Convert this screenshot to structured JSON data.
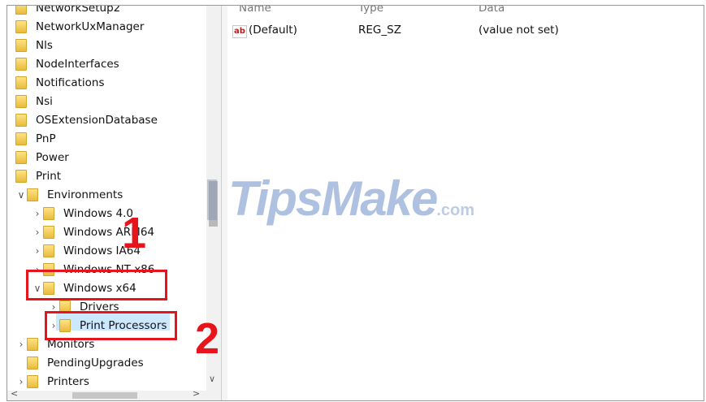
{
  "tree": {
    "items": [
      {
        "label": "NetworkSetup2",
        "expander": "",
        "level": 0
      },
      {
        "label": "NetworkUxManager",
        "expander": "",
        "level": 0
      },
      {
        "label": "Nls",
        "expander": "",
        "level": 0
      },
      {
        "label": "NodeInterfaces",
        "expander": "",
        "level": 0
      },
      {
        "label": "Notifications",
        "expander": "",
        "level": 0
      },
      {
        "label": "Nsi",
        "expander": "",
        "level": 0
      },
      {
        "label": "OSExtensionDatabase",
        "expander": "",
        "level": 0
      },
      {
        "label": "PnP",
        "expander": "",
        "level": 0
      },
      {
        "label": "Power",
        "expander": "",
        "level": 0
      },
      {
        "label": "Print",
        "expander": "",
        "level": 0
      },
      {
        "label": "Environments",
        "expander": "expanded",
        "level": 1
      },
      {
        "label": "Windows 4.0",
        "expander": "collapsed",
        "level": 2
      },
      {
        "label": "Windows ARM64",
        "expander": "collapsed",
        "level": 2
      },
      {
        "label": "Windows IA64",
        "expander": "collapsed",
        "level": 2
      },
      {
        "label": "Windows NT x86",
        "expander": "collapsed",
        "level": 2
      },
      {
        "label": "Windows x64",
        "expander": "expanded",
        "level": 2
      },
      {
        "label": "Drivers",
        "expander": "collapsed",
        "level": 3
      },
      {
        "label": "Print Processors",
        "expander": "collapsed",
        "level": 3,
        "selected": true
      },
      {
        "label": "Monitors",
        "expander": "collapsed",
        "level": 1
      },
      {
        "label": "PendingUpgrades",
        "expander": "",
        "level": 1
      },
      {
        "label": "Printers",
        "expander": "collapsed",
        "level": 1
      }
    ]
  },
  "values_pane": {
    "columns": [
      "Name",
      "Type",
      "Data"
    ],
    "rows": [
      {
        "name": "(Default)",
        "type": "REG_SZ",
        "data": "(value not set)",
        "icon": "string-value-icon"
      }
    ]
  },
  "annotations": {
    "step1": "1",
    "step2": "2",
    "color": "#e8141c"
  },
  "watermark": {
    "brand": "TipsMake",
    "suffix": ".com"
  },
  "icons": {
    "chevron_expanded": "chevron-down-icon",
    "chevron_collapsed": "chevron-right-icon",
    "folder": "folder-icon"
  },
  "colors": {
    "selection": "#cce8ff",
    "folder": "#f0c548"
  }
}
